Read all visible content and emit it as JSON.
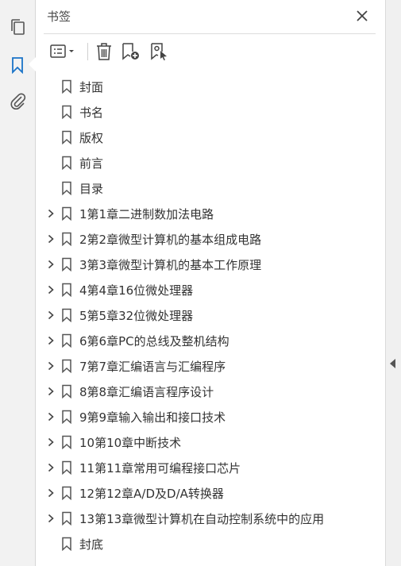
{
  "left_rail": {
    "icons": [
      "copy-pages-icon",
      "bookmark-icon",
      "paperclip-icon"
    ],
    "active": "bookmark-icon",
    "active_color": "#1a73c8"
  },
  "panel": {
    "title": "书签",
    "close_icon": "close-icon"
  },
  "toolbar": {
    "buttons": [
      "options-menu-icon",
      "delete-icon",
      "new-bookmark-icon",
      "bookmark-selection-icon"
    ]
  },
  "bookmarks": [
    {
      "label": "封面",
      "expandable": false
    },
    {
      "label": "书名",
      "expandable": false
    },
    {
      "label": "版权",
      "expandable": false
    },
    {
      "label": "前言",
      "expandable": false
    },
    {
      "label": "目录",
      "expandable": false
    },
    {
      "label": "1第1章二进制数加法电路",
      "expandable": true
    },
    {
      "label": "2第2章微型计算机的基本组成电路",
      "expandable": true
    },
    {
      "label": "3第3章微型计算机的基本工作原理",
      "expandable": true
    },
    {
      "label": "4第4章16位微处理器",
      "expandable": true
    },
    {
      "label": "5第5章32位微处理器",
      "expandable": true
    },
    {
      "label": "6第6章PC的总线及整机结构",
      "expandable": true
    },
    {
      "label": "7第7章汇编语言与汇编程序",
      "expandable": true
    },
    {
      "label": "8第8章汇编语言程序设计",
      "expandable": true
    },
    {
      "label": "9第9章输入输出和接口技术",
      "expandable": true
    },
    {
      "label": "10第10章中断技术",
      "expandable": true
    },
    {
      "label": "11第11章常用可编程接口芯片",
      "expandable": true
    },
    {
      "label": "12第12章A/D及D/A转换器",
      "expandable": true
    },
    {
      "label": "13第13章微型计算机在自动控制系统中的应用",
      "expandable": true
    },
    {
      "label": "封底",
      "expandable": false
    }
  ]
}
